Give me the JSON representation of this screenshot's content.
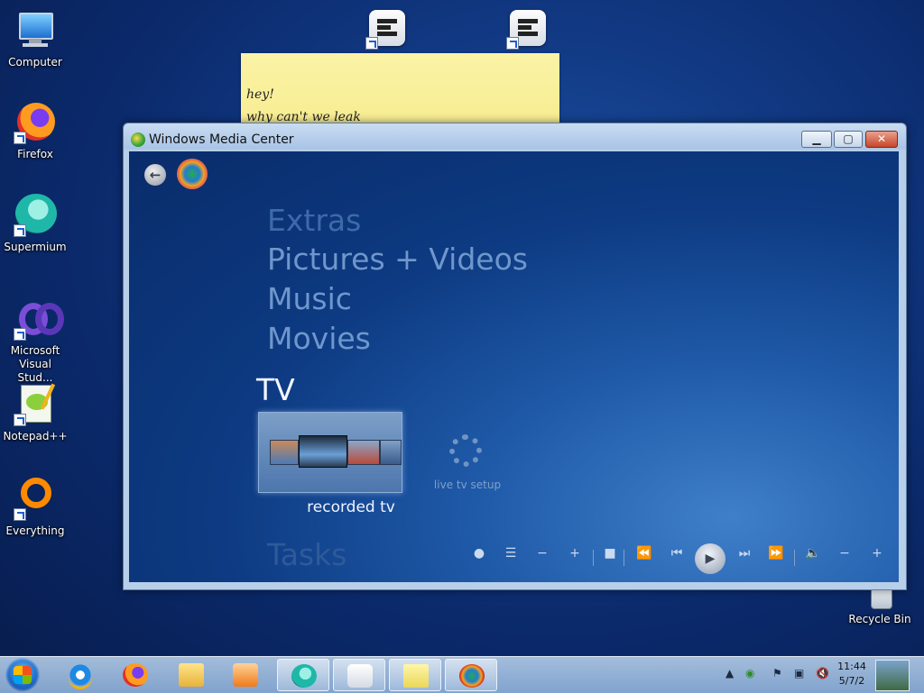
{
  "desktop_icons": [
    {
      "name": "computer",
      "label": "Computer",
      "shortcut": false
    },
    {
      "name": "firefox",
      "label": "Firefox",
      "shortcut": true
    },
    {
      "name": "supermium",
      "label": "Supermium",
      "shortcut": true
    },
    {
      "name": "visual-studio",
      "label": "Microsoft Visual Stud...",
      "shortcut": true
    },
    {
      "name": "notepadpp",
      "label": "Notepad++",
      "shortcut": true
    },
    {
      "name": "everything",
      "label": "Everything",
      "shortcut": true
    }
  ],
  "recycle_bin": {
    "label": "Recycle Bin"
  },
  "sticky_note": {
    "lines": [
      "hey!",
      "why can't we leak"
    ]
  },
  "window": {
    "title": "Windows Media Center",
    "controls": {
      "minimize": "▁",
      "maximize": "▢",
      "close": "✕"
    }
  },
  "media_center": {
    "menu": {
      "extras": "Extras",
      "pictures_videos": "Pictures + Videos",
      "music": "Music",
      "movies": "Movies",
      "tv": "TV",
      "tasks": "Tasks"
    },
    "tiles": {
      "recorded_tv": "recorded tv",
      "live_tv_setup": "live tv setup"
    },
    "transport_icons": [
      "record-icon",
      "guide-icon",
      "channel-down-icon",
      "channel-up-icon",
      "stop-icon",
      "rewind-icon",
      "skip-back-icon",
      "play-icon",
      "skip-forward-icon",
      "fast-forward-icon",
      "volume-icon",
      "volume-down-icon",
      "volume-up-icon"
    ]
  },
  "taskbar": {
    "pinned": [
      "internet-explorer",
      "firefox",
      "file-explorer",
      "media-player",
      "supermium",
      "sticky-notes-app",
      "sticky-notes-window",
      "media-center"
    ],
    "active": [
      "supermium",
      "sticky-notes-app",
      "sticky-notes-window",
      "media-center"
    ],
    "clock_time": "11:44",
    "clock_date": "5/7/2"
  },
  "colors": {
    "desktop": "#0b2a6c",
    "accent": "#bcd3f1",
    "sticky": "#fbf3a6"
  }
}
